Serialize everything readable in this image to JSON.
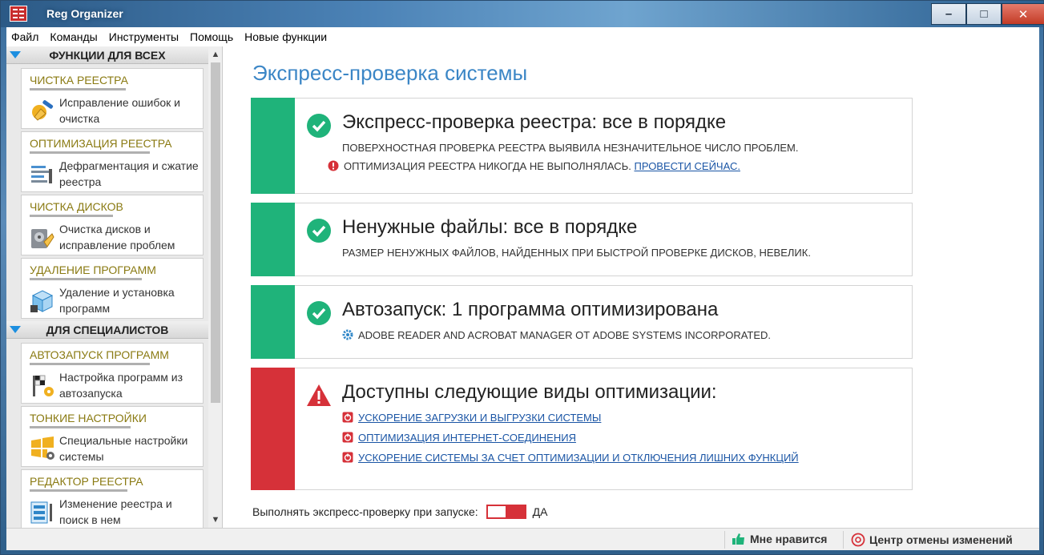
{
  "window": {
    "title": "Reg Organizer"
  },
  "menu": [
    "Файл",
    "Команды",
    "Инструменты",
    "Помощь",
    "Новые функции"
  ],
  "sidebar": {
    "sections": [
      {
        "title": "ФУНКЦИИ ДЛЯ ВСЕХ",
        "items": [
          {
            "title": "ЧИСТКА РЕЕСТРА",
            "desc": "Исправление ошибок и очистка",
            "icon": "broom-icon"
          },
          {
            "title": "ОПТИМИЗАЦИЯ РЕЕСТРА",
            "desc": "Дефрагментация и сжатие реестра",
            "icon": "defrag-icon"
          },
          {
            "title": "ЧИСТКА ДИСКОВ",
            "desc": "Очистка дисков и исправление проблем",
            "icon": "disk-clean-icon"
          },
          {
            "title": "УДАЛЕНИЕ ПРОГРАММ",
            "desc": "Удаление и установка программ",
            "icon": "uninstall-box-icon"
          }
        ]
      },
      {
        "title": "ДЛЯ СПЕЦИАЛИСТОВ",
        "items": [
          {
            "title": "АВТОЗАПУСК ПРОГРАММ",
            "desc": "Настройка программ из автозапуска",
            "icon": "startup-flag-icon"
          },
          {
            "title": "ТОНКИЕ НАСТРОЙКИ",
            "desc": "Специальные настройки системы",
            "icon": "windows-gear-icon"
          },
          {
            "title": "РЕДАКТОР РЕЕСТРА",
            "desc": "Изменение реестра и поиск в нем",
            "icon": "registry-editor-icon"
          }
        ]
      }
    ]
  },
  "main": {
    "title": "Экспресс-проверка системы",
    "panels": [
      {
        "status": "ok",
        "heading": "Экспресс-проверка реестра: все в порядке",
        "line1": "ПОВЕРХНОСТНАЯ ПРОВЕРКА РЕЕСТРА ВЫЯВИЛА НЕЗНАЧИТЕЛЬНОЕ ЧИСЛО ПРОБЛЕМ.",
        "line2": "ОПТИМИЗАЦИЯ РЕЕСТРА НИКОГДА НЕ ВЫПОЛНЯЛАСЬ.",
        "line2_link": "ПРОВЕСТИ СЕЙЧАС."
      },
      {
        "status": "ok",
        "heading": "Ненужные файлы: все в порядке",
        "line1": "РАЗМЕР НЕНУЖНЫХ ФАЙЛОВ, НАЙДЕННЫХ ПРИ БЫСТРОЙ ПРОВЕРКЕ ДИСКОВ, НЕВЕЛИК."
      },
      {
        "status": "ok",
        "heading": "Автозапуск: 1 программа оптимизирована",
        "line1": "ADOBE READER AND ACROBAT MANAGER ОТ ADOBE SYSTEMS INCORPORATED."
      },
      {
        "status": "warning",
        "heading": "Доступны следующие виды оптимизации:",
        "links": [
          "УСКОРЕНИЕ ЗАГРУЗКИ И ВЫГРУЗКИ СИСТЕМЫ",
          "ОПТИМИЗАЦИЯ ИНТЕРНЕТ-СОЕДИНЕНИЯ",
          "УСКОРЕНИЕ СИСТЕМЫ ЗА СЧЕТ ОПТИМИЗАЦИИ И ОТКЛЮЧЕНИЯ ЛИШНИХ ФУНКЦИЙ"
        ]
      }
    ],
    "toggle": {
      "label": "Выполнять экспресс-проверку при запуске:",
      "value": "ДА"
    }
  },
  "statusbar": {
    "like": "Мне нравится",
    "undo_center": "Центр отмены изменений"
  },
  "colors": {
    "accent_blue": "#3b86c6",
    "ok_green": "#1fb37a",
    "warn_red": "#d63139",
    "card_title": "#8a7a12"
  }
}
